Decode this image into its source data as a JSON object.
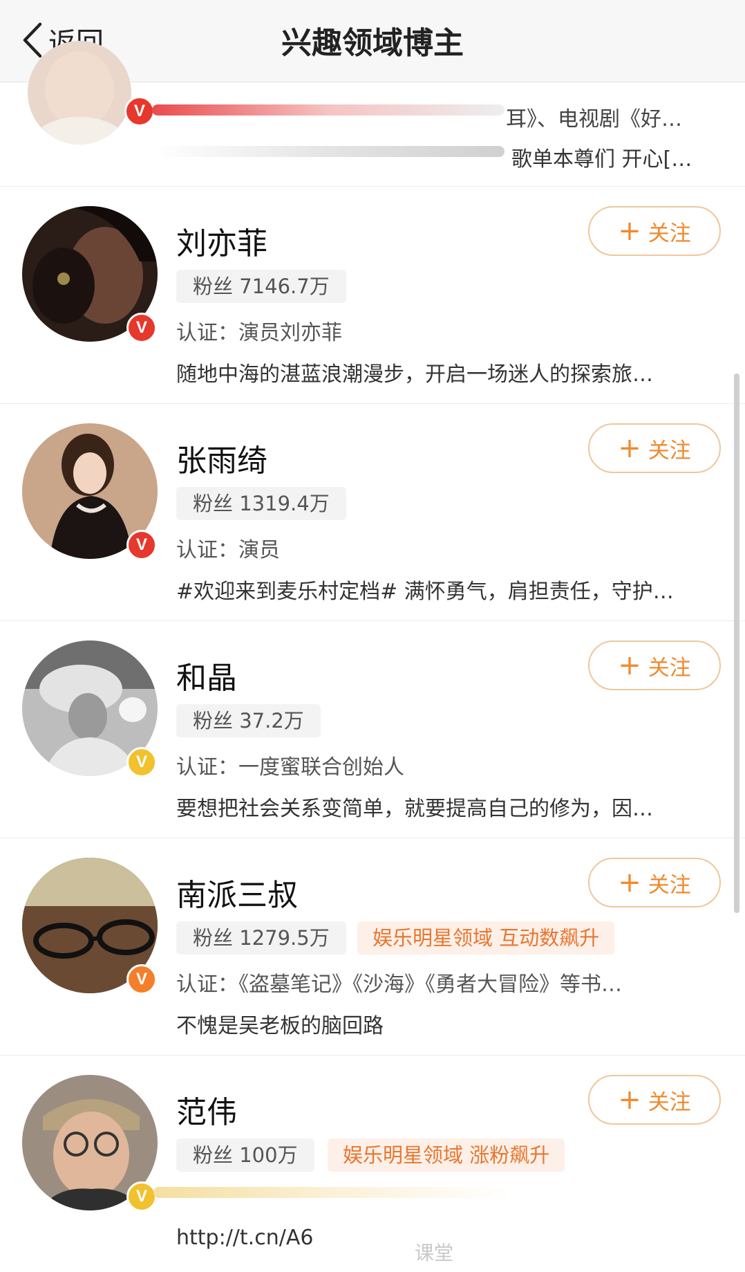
{
  "nav": {
    "back_label": "返回",
    "title": "兴趣领域博主"
  },
  "partial_card": {
    "verify": "耳》、电视剧《好…",
    "bio": "歌单本尊们 开心[…"
  },
  "bloggers": [
    {
      "name": "刘亦菲",
      "fans": "粉丝 7146.7万",
      "verify": "认证：演员刘亦菲",
      "bio": "随地中海的湛蓝浪潮漫步，开启一场迷人的探索旅…",
      "follow_label": "关注",
      "badge": "red"
    },
    {
      "name": "张雨绮",
      "fans": "粉丝 1319.4万",
      "verify": "认证：演员",
      "bio": "#欢迎来到麦乐村定档# 满怀勇气，肩担责任，守护…",
      "follow_label": "关注",
      "badge": "red"
    },
    {
      "name": "和晶",
      "fans": "粉丝 37.2万",
      "verify": "认证：一度蜜联合创始人",
      "bio": "要想把社会关系变简单，就要提高自己的修为，因…",
      "follow_label": "关注",
      "badge": "gold"
    },
    {
      "name": "南派三叔",
      "fans": "粉丝 1279.5万",
      "tag": "娱乐明星领域 互动数飙升",
      "verify": "认证：《盗墓笔记》《沙海》《勇者大冒险》等书…",
      "bio": "不愧是吴老板的脑回路",
      "follow_label": "关注",
      "badge": "orange"
    },
    {
      "name": "范伟",
      "fans": "粉丝 100万",
      "tag": "娱乐明星领域 涨粉飙升",
      "verify": "",
      "bio": "http://t.cn/A6",
      "follow_label": "关注",
      "badge": "gold"
    }
  ],
  "verified_badge_glyph": "V",
  "follow_plus_glyph": "+",
  "watermark": "课堂",
  "colors": {
    "accent": "#f08a2d",
    "tag_text": "#e8762f",
    "badge_red": "#e6382c",
    "badge_gold": "#f2c12e",
    "badge_orange": "#f47f2b"
  }
}
